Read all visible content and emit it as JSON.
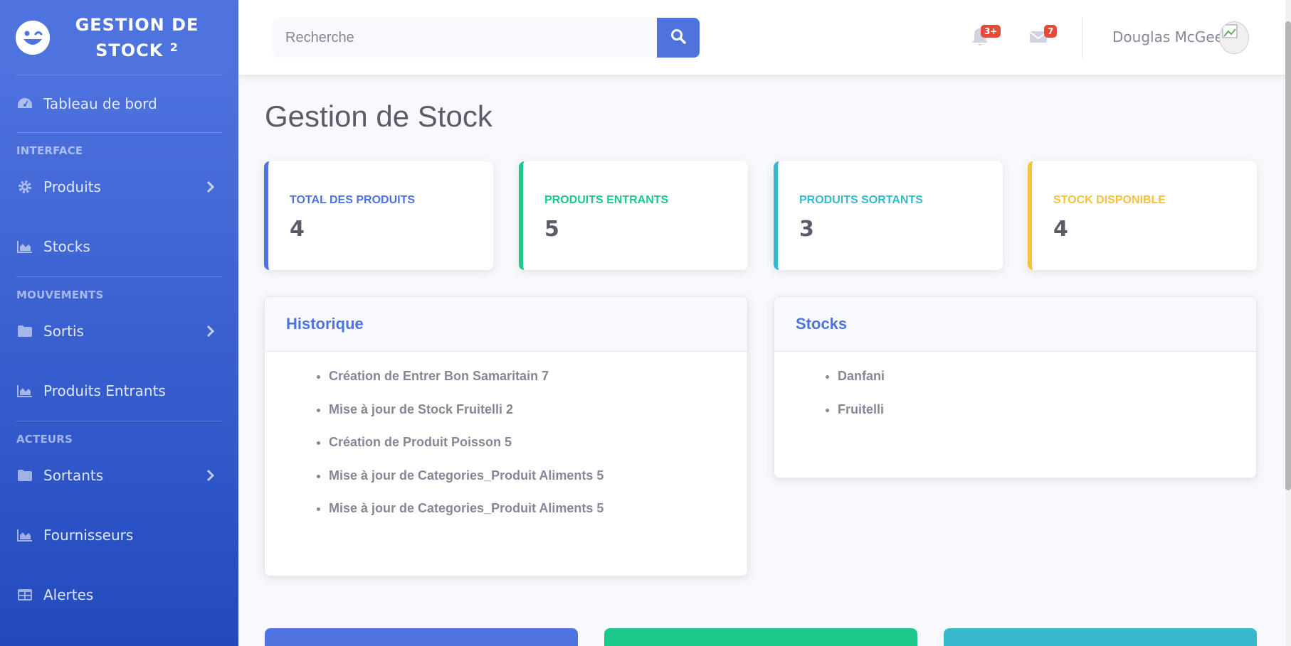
{
  "brand": {
    "line1": "GESTION DE",
    "line2": "STOCK",
    "sup": "2"
  },
  "sidebar": {
    "dashboard": "Tableau de bord",
    "heading_interface": "INTERFACE",
    "produits": "Produits",
    "stocks": "Stocks",
    "heading_mouvements": "MOUVEMENTS",
    "sortis": "Sortis",
    "produits_entrants": "Produits Entrants",
    "heading_acteurs": "ACTEURS",
    "sortants": "Sortants",
    "fournisseurs": "Fournisseurs",
    "alertes": "Alertes"
  },
  "topbar": {
    "search_placeholder": "Recherche",
    "alerts_badge": "3+",
    "messages_badge": "7",
    "user_name": "Douglas McGee"
  },
  "page_title": "Gestion de Stock",
  "stats": [
    {
      "label": "TOTAL DES PRODUITS",
      "value": "4",
      "color": "#4e73df"
    },
    {
      "label": "PRODUITS ENTRANTS",
      "value": "5",
      "color": "#1cc88a"
    },
    {
      "label": "PRODUITS SORTANTS",
      "value": "3",
      "color": "#36b9cc"
    },
    {
      "label": "STOCK DISPONIBLE",
      "value": "4",
      "color": "#f6c23e"
    }
  ],
  "historique": {
    "title": "Historique",
    "items": [
      "Création de Entrer Bon Samaritain 7",
      "Mise à jour de Stock Fruitelli 2",
      "Création de Produit Poisson 5",
      "Mise à jour de Categories_Produit Aliments 5",
      "Mise à jour de Categories_Produit Aliments 5"
    ]
  },
  "stocks_panel": {
    "title": "Stocks",
    "items": [
      "Danfani",
      "Fruitelli"
    ]
  },
  "colors": {
    "primary": "#4e73df",
    "success": "#1cc88a",
    "info": "#36b9cc",
    "warning": "#f6c23e",
    "danger": "#e74a3b"
  }
}
